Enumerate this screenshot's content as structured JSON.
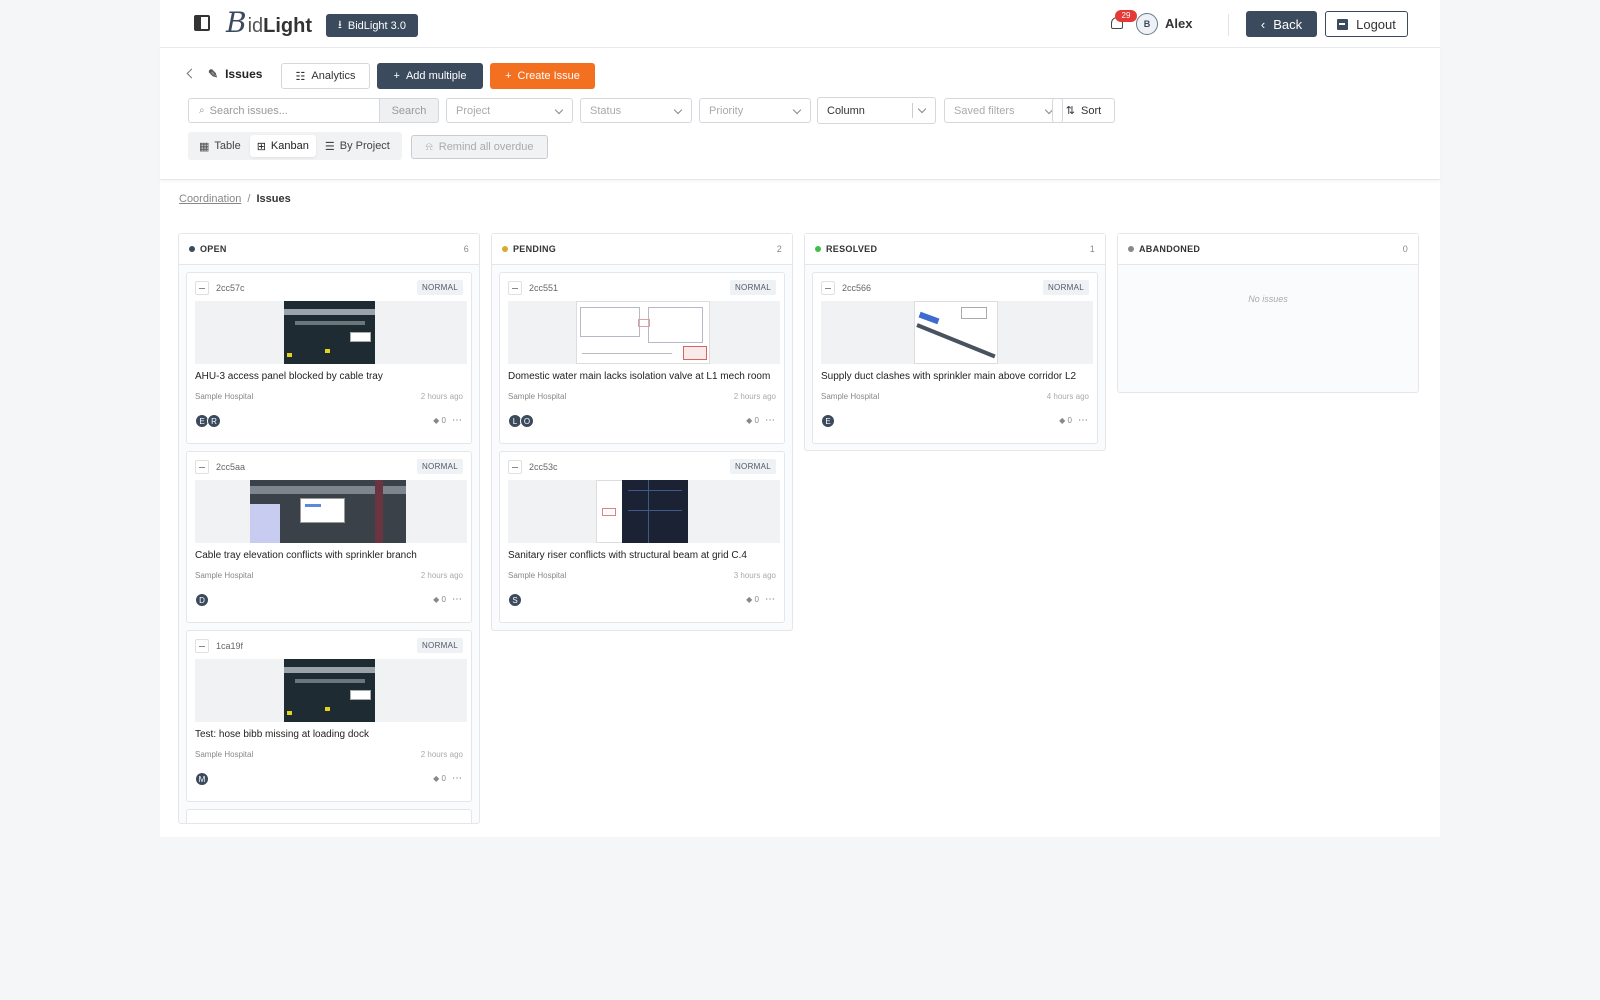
{
  "header": {
    "logo_initial": "B",
    "logo_light": "id",
    "logo_bold": "Light",
    "version_label": "BidLight 3.0",
    "notification_count": "29",
    "avatar_initials": "B",
    "user_name": "Alex",
    "back_label": "Back",
    "logout_label": "Logout"
  },
  "toolbar": {
    "page_title": "Issues",
    "analytics_label": "Analytics",
    "add_multiple_label": "Add multiple",
    "create_issue_label": "Create Issue",
    "search_placeholder": "Search issues...",
    "search_button": "Search",
    "filters": {
      "project": "Project",
      "status": "Status",
      "priority": "Priority",
      "column": "Column",
      "saved_filters": "Saved filters"
    },
    "sort_label": "Sort",
    "views": [
      "Table",
      "Kanban",
      "By Project"
    ],
    "active_view": "Kanban",
    "remind_label": "Remind all overdue"
  },
  "breadcrumb": {
    "parent": "Coordination",
    "separator": "/",
    "current": "Issues"
  },
  "colors": {
    "primary": "#3b4a5c",
    "accent": "#f37021",
    "open": "#3b4a5c",
    "pending": "#e0a72e",
    "resolved": "#3fbf4e",
    "abandoned": "#888888"
  },
  "columns": [
    {
      "title": "OPEN",
      "count": "6",
      "cards": [
        {
          "id": "2cc57c",
          "priority": "NORMAL",
          "title": "AHU-3 access panel blocked by cable tray",
          "project": "Sample Hospital",
          "time": "2 hours ago",
          "assignees": [
            "E",
            "R"
          ],
          "comments": "0"
        },
        {
          "id": "2cc5aa",
          "priority": "NORMAL",
          "title": "Cable tray elevation conflicts with sprinkler branch",
          "project": "Sample Hospital",
          "time": "2 hours ago",
          "assignees": [
            "D"
          ],
          "comments": "0"
        },
        {
          "id": "1ca19f",
          "priority": "NORMAL",
          "title": "Test: hose bibb missing at loading dock",
          "project": "Sample Hospital",
          "time": "2 hours ago",
          "assignees": [
            "M"
          ],
          "comments": "0"
        }
      ]
    },
    {
      "title": "PENDING",
      "count": "2",
      "cards": [
        {
          "id": "2cc551",
          "priority": "NORMAL",
          "title": "Domestic water main lacks isolation valve at L1 mech room",
          "project": "Sample Hospital",
          "time": "2 hours ago",
          "assignees": [
            "L",
            "O"
          ],
          "comments": "0"
        },
        {
          "id": "2cc53c",
          "priority": "NORMAL",
          "title": "Sanitary riser conflicts with structural beam at grid C.4",
          "project": "Sample Hospital",
          "time": "3 hours ago",
          "assignees": [
            "S"
          ],
          "comments": "0"
        }
      ]
    },
    {
      "title": "RESOLVED",
      "count": "1",
      "cards": [
        {
          "id": "2cc566",
          "priority": "NORMAL",
          "title": "Supply duct clashes with sprinkler main above corridor L2",
          "project": "Sample Hospital",
          "time": "4 hours ago",
          "assignees": [
            "E"
          ],
          "comments": "0"
        }
      ]
    },
    {
      "title": "ABANDONED",
      "count": "0",
      "empty_text": "No issues"
    }
  ]
}
